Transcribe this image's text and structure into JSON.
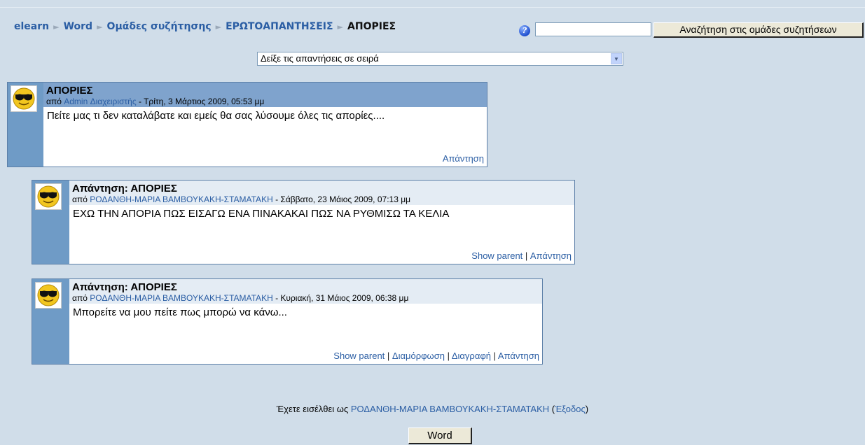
{
  "breadcrumb": {
    "items": [
      "elearn",
      "Word",
      "Ομάδες συζήτησης",
      "ΕΡΩΤΟΑΠΑΝΤΗΣΕΙΣ"
    ],
    "current": "ΑΠΟΡΙΕΣ",
    "separator": "►"
  },
  "search": {
    "help_icon": "?",
    "value": "",
    "button_label": "Αναζήτηση στις ομάδες συζητήσεων"
  },
  "display_mode": {
    "selected": "Δείξε τις απαντήσεις σε σειρά",
    "arrow": "▼"
  },
  "posts": [
    {
      "title": "ΑΠΟΡΙΕΣ",
      "by": "από",
      "author": "Admin Διαχειριστής",
      "date": " - Τρίτη, 3 Μάρτιος 2009, 05:53 μμ",
      "message": "Πείτε μας τι δεν καταλάβατε και εμείς θα σας λύσουμε όλες τις απορίες....",
      "commands": [
        "Απάντηση"
      ]
    },
    {
      "title": "Απάντηση: ΑΠΟΡΙΕΣ",
      "by": "από",
      "author": "ΡΟΔΑΝΘΗ-ΜΑΡΙΑ ΒΑΜΒΟΥΚΑΚΗ-ΣΤΑΜΑΤΑΚΗ",
      "date": " - Σάββατο, 23 Μάιος 2009, 07:13 μμ",
      "message": "ΕΧΩ ΤΗΝ ΑΠΟΡΙΑ ΠΩΣ ΕΙΣΑΓΩ ΕΝΑ ΠΙΝΑΚΑΚΑΙ ΠΩΣ ΝΑ ΡΥΘΜΙΣΩ ΤΑ ΚΕΛΙΑ",
      "commands": [
        "Show parent",
        "Απάντηση"
      ]
    },
    {
      "title": "Απάντηση: ΑΠΟΡΙΕΣ",
      "by": "από",
      "author": "ΡΟΔΑΝΘΗ-ΜΑΡΙΑ ΒΑΜΒΟΥΚΑΚΗ-ΣΤΑΜΑΤΑΚΗ",
      "date": " - Κυριακή, 31 Μάιος 2009, 06:38 μμ",
      "message": "Μπορείτε να μου πείτε πως μπορώ να κάνω...",
      "commands": [
        "Show parent",
        "Διαμόρφωση",
        "Διαγραφή",
        "Απάντηση"
      ]
    }
  ],
  "footer": {
    "logged_in_prefix": "Έχετε εισέλθει ως ",
    "user": "ΡΟΔΑΝΘΗ-ΜΑΡΙΑ ΒΑΜΒΟΥΚΑΚΗ-ΣΤΑΜΑΤΑΚΗ",
    "logout_open": " (",
    "logout": "Έξοδος",
    "logout_close": ")",
    "home_button": "Word"
  },
  "colors": {
    "page_bg": "#d0dde9",
    "link": "#2b5ea4",
    "post_side": "#6f9bc6",
    "post_header_main": "#7fa3cd"
  },
  "icons": {
    "avatar": "smiley-sunglasses-avatar",
    "help": "help-icon"
  }
}
